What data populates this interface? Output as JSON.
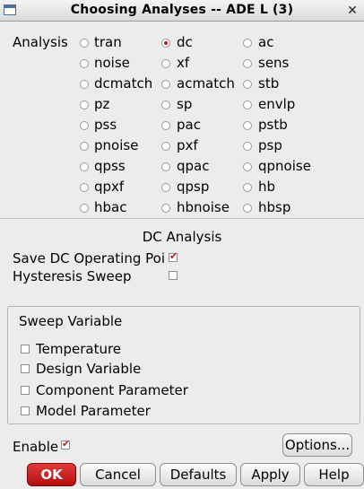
{
  "window": {
    "title": "Choosing Analyses -- ADE L (3)"
  },
  "analysis": {
    "label": "Analysis",
    "options": [
      [
        "tran",
        "dc",
        "ac"
      ],
      [
        "noise",
        "xf",
        "sens"
      ],
      [
        "dcmatch",
        "acmatch",
        "stb"
      ],
      [
        "pz",
        "sp",
        "envlp"
      ],
      [
        "pss",
        "pac",
        "pstb"
      ],
      [
        "pnoise",
        "pxf",
        "psp"
      ],
      [
        "qpss",
        "qpac",
        "qpnoise"
      ],
      [
        "qpxf",
        "qpsp",
        "hb"
      ],
      [
        "hbac",
        "hbnoise",
        "hbsp"
      ]
    ],
    "selected": "dc"
  },
  "dc": {
    "section_title": "DC Analysis",
    "save_op_label": "Save DC Operating Poi",
    "save_op_checked": true,
    "hysteresis_label": "Hysteresis Sweep",
    "hysteresis_checked": false
  },
  "sweep": {
    "title": "Sweep Variable",
    "items": [
      {
        "label": "Temperature",
        "checked": false
      },
      {
        "label": "Design Variable",
        "checked": false
      },
      {
        "label": "Component Parameter",
        "checked": false
      },
      {
        "label": "Model Parameter",
        "checked": false
      }
    ]
  },
  "enable": {
    "label": "Enable",
    "checked": true
  },
  "buttons": {
    "options": "Options...",
    "ok": "OK",
    "cancel": "Cancel",
    "defaults": "Defaults",
    "apply": "Apply",
    "help": "Help"
  }
}
